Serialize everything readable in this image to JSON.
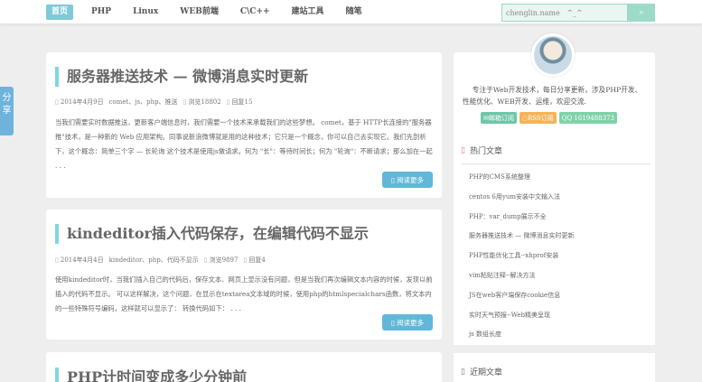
{
  "nav": {
    "items": [
      "首页",
      "PHP",
      "Linux",
      "WEB前端",
      "C\\C++",
      "建站工具",
      "随笔"
    ]
  },
  "search": {
    "value": "chenglin.name   ^_^",
    "button": "⌕"
  },
  "share": {
    "label": "分享"
  },
  "posts": [
    {
      "title": "服务器推送技术 — 微博消息实时更新",
      "meta": [
        "2014年4月9日",
        "comet、js、php、推送",
        "浏览18802",
        "回复15"
      ],
      "excerpt": "当我们需要实时数据推送，更新客户端信息时，我们需要一个技术来承载我们的这些梦想。 comet，基于 HTTP长连接的\"服务器推\"技术，是一种新的 Web 应用架构。同事说新浪微博就是用的这种技术；它只是一个概念，你可以自己去实现它。我们先剖析下，这个概念：简单三个字 — 长轮询 这个技术是使用js做请求。何为 \"长\"：等待时间长；何为 \"轮询\"：不断请求；那么加在一起 . . .",
      "read_more": "阅读更多"
    },
    {
      "title": "kindeditor插入代码保存，在编辑代码不显示",
      "meta": [
        "2014年4月4日",
        "kindeditor、php、代码不显示",
        "浏览9897",
        "回复4"
      ],
      "excerpt": "使用kindeditor时，当我们插入自己的代码后，保存文本、网页上显示没有问题，但是当我们再次编辑文本内容的时候，发现以前插入的代码不显示。 可以这样解决，这个问题，在显示在textarea文本域的时候，使用php的htmlspecialchars函数，将文本内的一些特殊符号编码，这样就可以显示了： 转换代码如下： . . .",
      "read_more": "阅读更多"
    },
    {
      "title": "PHP计时间变成多少分钟前"
    }
  ],
  "profile": {
    "text": "专注于Web开发技术，每日分享更新，涉及PHP开发、性能优化、WEB开发、运维，欢迎交流.",
    "badges": [
      "邮箱订阅",
      "RSS订阅",
      "QQ 1619488373"
    ]
  },
  "hot": {
    "title": "热门文章",
    "items": [
      "PHP的CMS系统整理",
      "centos 6用yum安装中文输入法",
      "PHP：var_dump展示不全",
      "服务器推送技术 — 微博消息实时更新",
      "PHP性能优化工具--xhprof安装",
      "vim粘贴注释--解决方法",
      "JS在web客户端保存cookie信息",
      "实时天气预报--Web精美呈现",
      "js 数组长度"
    ]
  },
  "recent": {
    "title": "近期文章"
  },
  "colors": {
    "accent": "#62b7d8",
    "title_bar": "#7fd6e0",
    "nav_active": "#7fc9d9"
  }
}
